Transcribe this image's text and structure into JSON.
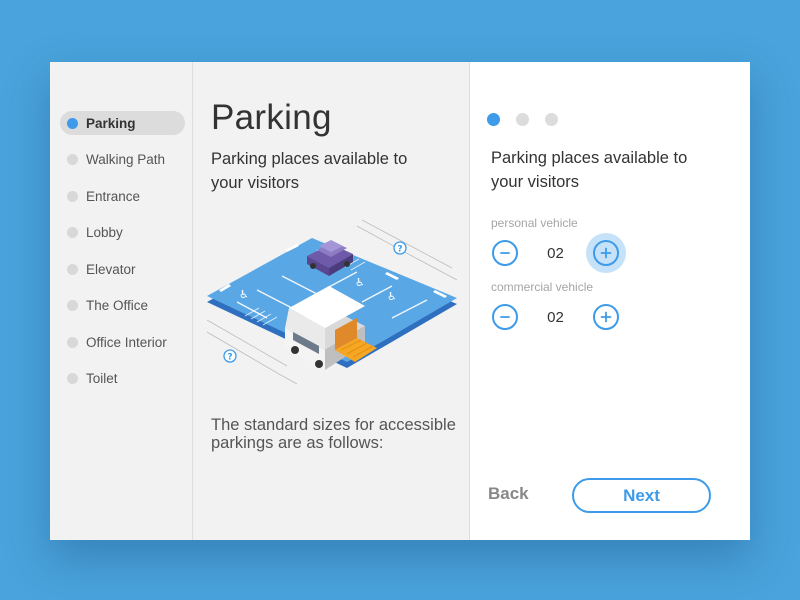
{
  "colors": {
    "background": "#4aa3dc",
    "accent": "#3d9be9",
    "active_halo": "#c6e2f8"
  },
  "sidebar": {
    "items": [
      {
        "label": "Parking",
        "active": true
      },
      {
        "label": "Walking Path",
        "active": false
      },
      {
        "label": "Entrance",
        "active": false
      },
      {
        "label": "Lobby",
        "active": false
      },
      {
        "label": "Elevator",
        "active": false
      },
      {
        "label": "The Office",
        "active": false
      },
      {
        "label": "Office Interior",
        "active": false
      },
      {
        "label": "Toilet",
        "active": false
      }
    ]
  },
  "main": {
    "title": "Parking",
    "subtitle": "Parking places available to your visitors",
    "illustration": {
      "icon": "isometric-parking-lot",
      "markers": [
        "?",
        "?"
      ]
    },
    "info_text": "The standard sizes for accessible parkings are as follows:"
  },
  "form": {
    "steps": {
      "total": 3,
      "current": 1
    },
    "subtitle": "Parking places available to your visitors",
    "counters": [
      {
        "label": "personal vehicle",
        "value": "02",
        "decrement_icon": "minus-icon",
        "increment_icon": "plus-icon"
      },
      {
        "label": "commercial vehicle",
        "value": "02",
        "decrement_icon": "minus-icon",
        "increment_icon": "plus-icon"
      }
    ],
    "back_label": "Back",
    "next_label": "Next"
  }
}
